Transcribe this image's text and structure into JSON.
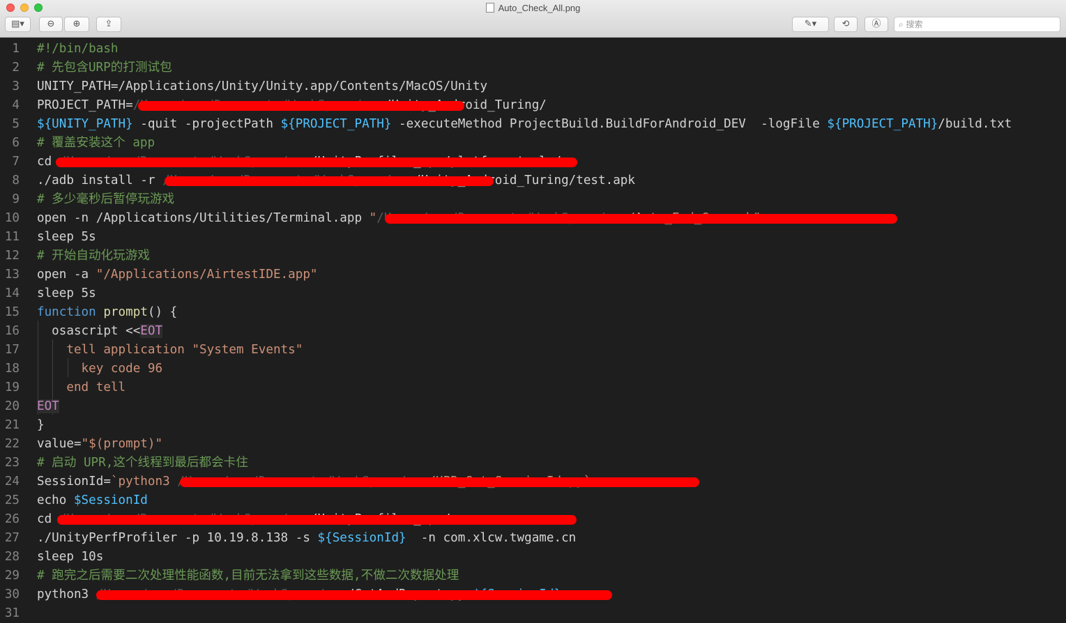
{
  "window": {
    "title": "Auto_Check_All.png",
    "search_placeholder": "搜索"
  },
  "toolbar": {
    "sidebar_label": "▤▾",
    "zoom_out_label": "⊖",
    "zoom_in_label": "⊕",
    "share_label": "⇪",
    "markup_label": "✎▾",
    "rotate_label": "⟲",
    "annotate_label": "Ⓐ"
  },
  "code_lines": [
    {
      "n": "1",
      "segs": [
        {
          "t": "#!/bin/bash",
          "c": "com"
        }
      ]
    },
    {
      "n": "2",
      "segs": [
        {
          "t": "# 先包含URP的打测试包",
          "c": "com"
        }
      ]
    },
    {
      "n": "3",
      "segs": [
        {
          "t": "UNITY_PATH=/Applications/Unity/Unity.app/Contents/MacOS/Unity",
          "c": "plain"
        }
      ]
    },
    {
      "n": "4",
      "segs": [
        {
          "t": "PROJECT_PATH=",
          "c": "plain"
        },
        {
          "t": "/Users/.../Documents/WorkSpace/...",
          "c": "redacted"
        },
        {
          "t": "/Unity_Android_Turing/",
          "c": "plain"
        }
      ]
    },
    {
      "n": "5",
      "segs": [
        {
          "t": "${UNITY_PATH}",
          "c": "var"
        },
        {
          "t": " -quit -projectPath ",
          "c": "plain"
        },
        {
          "t": "${PROJECT_PATH}",
          "c": "var"
        },
        {
          "t": " -executeMethod ProjectBuild.BuildForAndroid_DEV  -logFile ",
          "c": "plain"
        },
        {
          "t": "${PROJECT_PATH}",
          "c": "var"
        },
        {
          "t": "/build.txt",
          "c": "plain"
        }
      ]
    },
    {
      "n": "6",
      "segs": [
        {
          "t": "# 覆盖安装这个 app",
          "c": "com"
        }
      ]
    },
    {
      "n": "7",
      "segs": [
        {
          "t": "cd ",
          "c": "plain"
        },
        {
          "t": "/Users/.../Documents/WorkSpace/...",
          "c": "redacted"
        },
        {
          "t": "/UnityProfiler_upr/platform-tools/",
          "c": "plain"
        }
      ]
    },
    {
      "n": "8",
      "segs": [
        {
          "t": "./adb install -r ",
          "c": "plain"
        },
        {
          "t": "/Users/.../Documents/WorkSpace/...",
          "c": "redacted"
        },
        {
          "t": "/Unity_Android_Turing/test.apk",
          "c": "plain"
        }
      ]
    },
    {
      "n": "9",
      "segs": [
        {
          "t": "# 多少毫秒后暂停玩游戏",
          "c": "com"
        }
      ]
    },
    {
      "n": "10",
      "segs": [
        {
          "t": "open -n /Applications/Utilities/Terminal.app ",
          "c": "plain"
        },
        {
          "t": "\"",
          "c": "str"
        },
        {
          "t": "/Users/.../Documents/WorkSpace/...",
          "c": "redacted"
        },
        {
          "t": "/Auto_End_Game.sh\"",
          "c": "str"
        }
      ]
    },
    {
      "n": "11",
      "segs": [
        {
          "t": "sleep 5s",
          "c": "plain"
        }
      ]
    },
    {
      "n": "12",
      "segs": [
        {
          "t": "# 开始自动化玩游戏",
          "c": "com"
        }
      ]
    },
    {
      "n": "13",
      "segs": [
        {
          "t": "open -a ",
          "c": "plain"
        },
        {
          "t": "\"/Applications/AirtestIDE.app\"",
          "c": "str"
        }
      ]
    },
    {
      "n": "14",
      "segs": [
        {
          "t": "sleep 5s",
          "c": "plain"
        }
      ]
    },
    {
      "n": "15",
      "segs": [
        {
          "t": "function",
          "c": "kw"
        },
        {
          "t": " ",
          "c": "plain"
        },
        {
          "t": "prompt",
          "c": "fn"
        },
        {
          "t": "() {",
          "c": "plain"
        }
      ]
    },
    {
      "n": "16",
      "segs": [
        {
          "t": "  osascript <<",
          "c": "plain"
        },
        {
          "t": "EOT",
          "c": "heredoc"
        }
      ]
    },
    {
      "n": "17",
      "segs": [
        {
          "t": "    tell application \"System Events\"",
          "c": "str"
        }
      ]
    },
    {
      "n": "18",
      "segs": [
        {
          "t": "      key code 96",
          "c": "str"
        }
      ]
    },
    {
      "n": "19",
      "segs": [
        {
          "t": "    end tell",
          "c": "str"
        }
      ]
    },
    {
      "n": "20",
      "segs": [
        {
          "t": "EOT",
          "c": "heredoc"
        }
      ]
    },
    {
      "n": "21",
      "segs": [
        {
          "t": "}",
          "c": "plain"
        }
      ]
    },
    {
      "n": "22",
      "segs": [
        {
          "t": "value=",
          "c": "plain"
        },
        {
          "t": "\"$(prompt)\"",
          "c": "str"
        }
      ]
    },
    {
      "n": "23",
      "segs": [
        {
          "t": "# 启动 UPR,这个线程到最后都会卡住",
          "c": "com"
        }
      ]
    },
    {
      "n": "24",
      "segs": [
        {
          "t": "SessionId=",
          "c": "plain"
        },
        {
          "t": "`python3 ",
          "c": "str"
        },
        {
          "t": "/Users/.../Documents/WorkSpace/...",
          "c": "redacted"
        },
        {
          "t": "/UPR_Get_SessionId.py`",
          "c": "str"
        }
      ]
    },
    {
      "n": "25",
      "segs": [
        {
          "t": "echo ",
          "c": "plain"
        },
        {
          "t": "$SessionId",
          "c": "var"
        }
      ]
    },
    {
      "n": "26",
      "segs": [
        {
          "t": "cd ",
          "c": "plain"
        },
        {
          "t": "/Users/.../Documents/WorkSpace/...",
          "c": "redacted"
        },
        {
          "t": "/UnityProfiler_upr/",
          "c": "plain"
        }
      ]
    },
    {
      "n": "27",
      "segs": [
        {
          "t": "./UnityPerfProfiler -p 10.19.8.138 -s ",
          "c": "plain"
        },
        {
          "t": "${SessionId}",
          "c": "var"
        },
        {
          "t": "  -n com.xlcw.twgame.cn",
          "c": "plain"
        }
      ]
    },
    {
      "n": "28",
      "segs": [
        {
          "t": "sleep 10s",
          "c": "plain"
        }
      ]
    },
    {
      "n": "29",
      "segs": [
        {
          "t": "# 跑完之后需要二次处理性能函数,目前无法拿到这些数据,不做二次数据处理",
          "c": "com"
        }
      ]
    },
    {
      "n": "30",
      "segs": [
        {
          "t": "python3 ",
          "c": "plain"
        },
        {
          "t": "/Users/.../Documents/WorkSpace/...",
          "c": "redacted"
        },
        {
          "t": "/GetAndReport.py ",
          "c": "plain"
        },
        {
          "t": "${SessionId}",
          "c": "var"
        }
      ]
    },
    {
      "n": "31",
      "segs": []
    }
  ]
}
